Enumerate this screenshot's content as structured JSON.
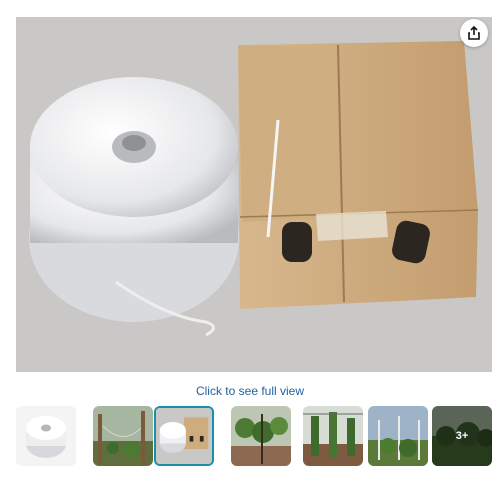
{
  "main_image": {
    "alt": "white twine spool beside cardboard box"
  },
  "share": {
    "icon": "share-icon"
  },
  "caption": "Click to see full view",
  "thumbnails": [
    {
      "name": "twine-spool",
      "selected": false
    },
    {
      "name": "garden-trellis-1",
      "selected": false
    },
    {
      "name": "spool-with-box",
      "selected": true
    },
    {
      "name": "tomato-plants",
      "selected": false
    },
    {
      "name": "garden-rows",
      "selected": false
    },
    {
      "name": "garden-trellis-2",
      "selected": false
    },
    {
      "name": "more-images",
      "selected": false,
      "more_label": "3+"
    }
  ],
  "colors": {
    "accent": "#1a8fa8",
    "link": "#2162a1"
  }
}
